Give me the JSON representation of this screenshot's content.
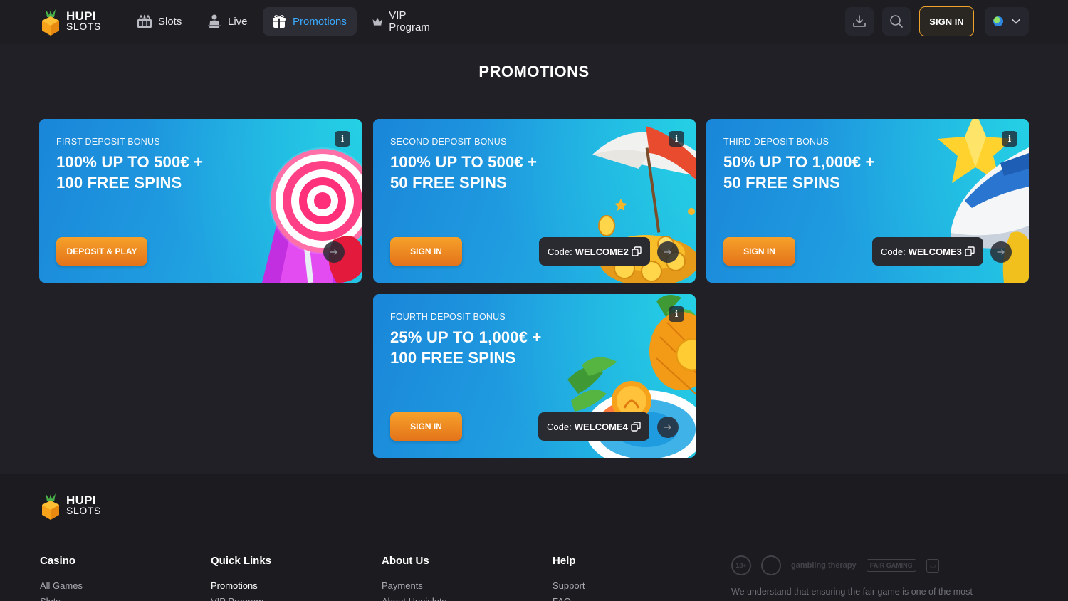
{
  "brand": {
    "line1": "HUPI",
    "line2": "SLOTS"
  },
  "nav": {
    "items": [
      {
        "label": "Slots",
        "icon": "slot-machine-icon"
      },
      {
        "label": "Live",
        "icon": "dealer-icon"
      },
      {
        "label": "Promotions",
        "icon": "gift-icon",
        "active": true
      },
      {
        "label": "VIP Program",
        "icon": "crown-icon"
      }
    ]
  },
  "header": {
    "signin_label": "SIGN IN",
    "download_icon": "download-icon",
    "search_icon": "search-icon",
    "language_icon": "globe-icon"
  },
  "page": {
    "title": "PROMOTIONS"
  },
  "cards": [
    {
      "subtitle": "FIRST DEPOSIT BONUS",
      "title": "100% UP TO 500€ + 100 FREE SPINS",
      "cta": "DEPOSIT & PLAY",
      "info": "i",
      "art": "lollipop-art"
    },
    {
      "subtitle": "SECOND DEPOSIT BONUS",
      "title": "100% UP TO 500€ + 50 FREE SPINS",
      "cta": "SIGN IN",
      "info": "i",
      "code_label": "Code:",
      "code": "WELCOME2",
      "art": "umbrella-coins-art"
    },
    {
      "subtitle": "THIRD DEPOSIT BONUS",
      "title": "50% UP TO 1,000€ + 50 FREE SPINS",
      "cta": "SIGN IN",
      "info": "i",
      "code_label": "Code:",
      "code": "WELCOME3",
      "art": "boat-star-art"
    },
    {
      "subtitle": "FOURTH DEPOSIT BONUS",
      "title": "25% UP TO 1,000€ + 100 FREE SPINS",
      "cta": "SIGN IN",
      "info": "i",
      "code_label": "Code:",
      "code": "WELCOME4",
      "art": "pineapple-float-art"
    }
  ],
  "footer": {
    "columns": [
      {
        "heading": "Casino",
        "links": [
          "All Games",
          "Slots"
        ]
      },
      {
        "heading": "Quick Links",
        "links": [
          "Promotions",
          "VIP Program"
        ]
      },
      {
        "heading": "About Us",
        "links": [
          "Payments",
          "About Hupislots"
        ]
      },
      {
        "heading": "Help",
        "links": [
          "Support",
          "FAQ"
        ]
      }
    ],
    "badges": [
      "18+",
      "gambling therapy",
      "FAIR GAMING"
    ],
    "fair_text": "We understand that ensuring the fair game is one of the most"
  },
  "colors": {
    "accent_orange": "#f0a32c",
    "accent_blue": "#3aa9ff",
    "bg": "#202026",
    "card_blue": "#1f9be0"
  }
}
